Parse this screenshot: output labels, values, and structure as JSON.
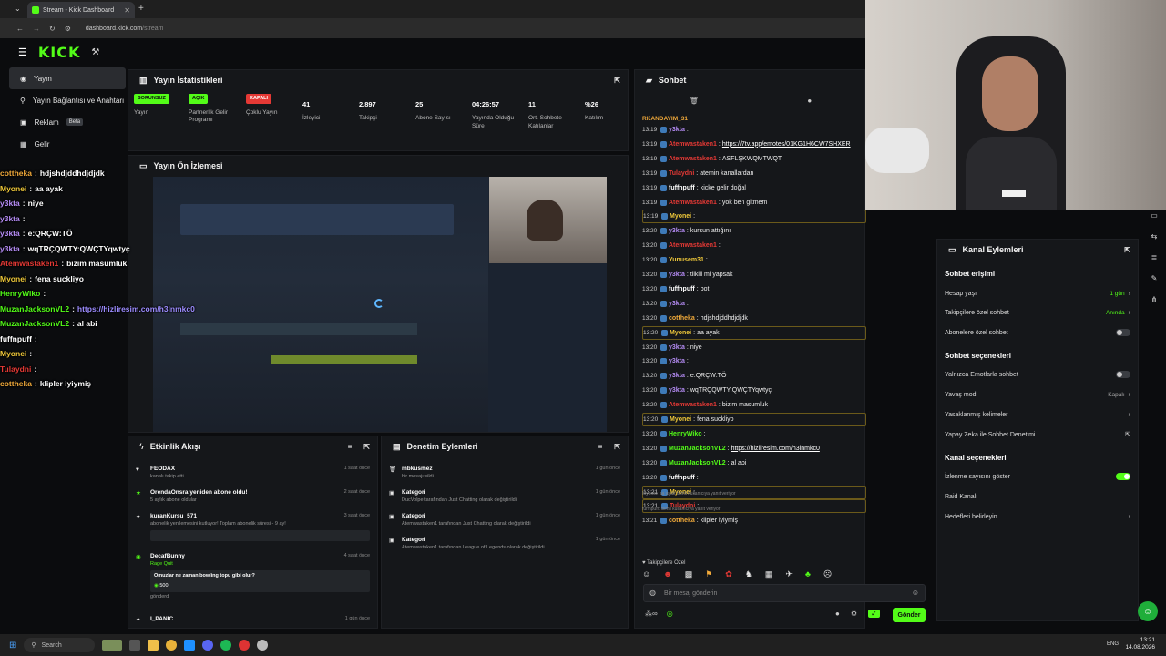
{
  "browser": {
    "tab_title": "Stream - Kick Dashboard",
    "url_host": "dashboard.kick.com",
    "url_path": "/stream"
  },
  "header": {
    "logo": "KICK"
  },
  "sidebar": {
    "items": [
      {
        "label": "Yayın",
        "icon": "broadcast-icon",
        "active": true
      },
      {
        "label": "Yayın Bağlantısı ve Anahtarı",
        "icon": "link-icon"
      },
      {
        "label": "Reklam",
        "icon": "ad-icon",
        "badge": "Beta"
      },
      {
        "label": "Gelir",
        "icon": "revenue-icon"
      }
    ]
  },
  "stats": {
    "title": "Yayın İstatistikleri",
    "items": [
      {
        "value": "SORUNSUZ",
        "label": "Yayın",
        "kind": "pill-green"
      },
      {
        "value": "AÇIK",
        "label": "Partnerlik Gelir Programı",
        "kind": "pill-green"
      },
      {
        "value": "KAPALI",
        "label": "Çoklu Yayın",
        "kind": "pill-red"
      },
      {
        "value": "41",
        "label": "İzleyici"
      },
      {
        "value": "2.897",
        "label": "Takipçi"
      },
      {
        "value": "25",
        "label": "Abone Sayısı"
      },
      {
        "value": "04:26:57",
        "label": "Yayında Olduğu Süre"
      },
      {
        "value": "11",
        "label": "Ort. Sohbete Katılanlar"
      },
      {
        "value": "%26",
        "label": "Katılım"
      }
    ]
  },
  "preview": {
    "title": "Yayın Ön İzlemesi"
  },
  "overlay_chat": [
    {
      "user": "cottheka",
      "msg": "hdjshdjddhdjdjdk",
      "color": "#f0a93a"
    },
    {
      "user": "Myonei",
      "msg": "aa ayak",
      "color": "#f0c93a"
    },
    {
      "user": "y3kta",
      "msg": "niye",
      "color": "#b58cf5"
    },
    {
      "user": "y3kta",
      "msg": "",
      "color": "#b58cf5"
    },
    {
      "user": "y3kta",
      "msg": "e:QRÇW:TÖ",
      "color": "#b58cf5"
    },
    {
      "user": "y3kta",
      "msg": "wqTRÇQWTY:QWÇTYqwtyç",
      "color": "#b58cf5"
    },
    {
      "user": "Atemwastaken1",
      "msg": "bizim masumluk",
      "color": "#e53935"
    },
    {
      "user": "Myonei",
      "msg": "fena suckliyo",
      "color": "#f0c93a"
    },
    {
      "user": "HenryWiko",
      "msg": "",
      "color": "#53fc18"
    },
    {
      "user": "MuzanJacksonVL2",
      "msg": "https://hizliresim.com/h3lnmkc0",
      "color": "#53fc18",
      "link": true
    },
    {
      "user": "MuzanJacksonVL2",
      "msg": "al abi",
      "color": "#53fc18"
    },
    {
      "user": "fuffnpuff",
      "msg": "",
      "color": "#ffffff"
    },
    {
      "user": "Myonei",
      "msg": "",
      "color": "#f0c93a"
    },
    {
      "user": "Tulaydni",
      "msg": "",
      "color": "#e53935"
    },
    {
      "user": "cottheka",
      "msg": "klipler iyiymiş",
      "color": "#f0a93a"
    }
  ],
  "activity": {
    "title": "Etkinlik Akışı",
    "items": [
      {
        "title": "FEODAX",
        "sub": "kanalı takip etti",
        "time": "1 saat önce"
      },
      {
        "title": "OrendaOnsra yeniden abone oldu!",
        "sub": "5 aylık abone oldular",
        "time": "2 saat önce"
      },
      {
        "title": "kuranKursu_571",
        "sub": "abonelik yenilemesini kutluyor! Toplam abonelik süresi - 9 ay!",
        "time": "3 saat önce"
      },
      {
        "title": "DecafBunny",
        "sub": "Rage Quit",
        "time": "4 saat önce"
      },
      {
        "title": "Omuzlar ne zaman bowling topu gibi olur?",
        "sub": "500",
        "time": ""
      },
      {
        "title": "gönderdi",
        "sub": "",
        "time": ""
      },
      {
        "title": "I_PANIC",
        "sub": "",
        "time": "1 gün önce"
      }
    ]
  },
  "moderation": {
    "title": "Denetim Eylemleri",
    "items": [
      {
        "title": "mbkusmez",
        "sub": "bir mesajı sildi",
        "time": "1 gün önce"
      },
      {
        "title": "Kategori",
        "sub": "DucVolpe tarafından Just Chatting olarak değiştirildi",
        "time": "1 gün önce"
      },
      {
        "title": "Kategori",
        "sub": "Atemwastaken1 tarafından Just Chatting olarak değiştirildi",
        "time": "1 gün önce"
      },
      {
        "title": "Kategori",
        "sub": "Atemwastaken1 tarafından League of Legends olarak değiştirildi",
        "time": "1 gün önce"
      }
    ]
  },
  "chat": {
    "title": "Sohbet",
    "pinned": "RKANDAYIM_31",
    "input_placeholder": "Bir mesaj gönderin",
    "send_label": "Gönder",
    "followers_only": "Takipçilere Özel",
    "reply_preview_1": "Myonei: aa ayak isimli kullanıcıya yanıt veriyor",
    "reply_preview_2": "fuffnpuff: isimli kullanıcıya yanıt veriyor",
    "lines": [
      {
        "time": "13:19",
        "user": "y3kta",
        "msg": "",
        "color": "#b58cf5"
      },
      {
        "time": "13:19",
        "user": "Atemwastaken1",
        "msg": "https://7tv.app/emotes/01KG1H6CW7SHXER",
        "color": "#e53935",
        "link": true
      },
      {
        "time": "13:19",
        "user": "Atemwastaken1",
        "msg": "ASFLŞKWQMTWQT",
        "color": "#e53935"
      },
      {
        "time": "13:19",
        "user": "Tulaydni",
        "msg": "atemin kanallardan",
        "color": "#e53935"
      },
      {
        "time": "13:19",
        "user": "fuffnpuff",
        "msg": "kicke gelir doğal",
        "color": "#ffffff"
      },
      {
        "time": "13:19",
        "user": "Atemwastaken1",
        "msg": "yok ben gitmem",
        "color": "#e53935"
      },
      {
        "time": "13:19",
        "user": "Myonei",
        "msg": "",
        "color": "#f0c93a",
        "hl": true
      },
      {
        "time": "13:20",
        "user": "y3kta",
        "msg": "kursun attığını",
        "color": "#b58cf5"
      },
      {
        "time": "13:20",
        "user": "Atemwastaken1",
        "msg": "",
        "color": "#e53935"
      },
      {
        "time": "13:20",
        "user": "Yunusem31",
        "msg": "",
        "color": "#f0c93a"
      },
      {
        "time": "13:20",
        "user": "y3kta",
        "msg": "tilkili mi yapsak",
        "color": "#b58cf5"
      },
      {
        "time": "13:20",
        "user": "fuffnpuff",
        "msg": "bot",
        "color": "#ffffff"
      },
      {
        "time": "13:20",
        "user": "y3kta",
        "msg": "",
        "color": "#b58cf5"
      },
      {
        "time": "13:20",
        "user": "cottheka",
        "msg": "hdjshdjddhdjdjdk",
        "color": "#f0a93a"
      },
      {
        "time": "13:20",
        "user": "Myonei",
        "msg": "aa ayak",
        "color": "#f0c93a",
        "hl": true
      },
      {
        "time": "13:20",
        "user": "y3kta",
        "msg": "niye",
        "color": "#b58cf5"
      },
      {
        "time": "13:20",
        "user": "y3kta",
        "msg": "",
        "color": "#b58cf5"
      },
      {
        "time": "13:20",
        "user": "y3kta",
        "msg": "e:QRÇW:TÖ",
        "color": "#b58cf5"
      },
      {
        "time": "13:20",
        "user": "y3kta",
        "msg": "wqTRÇQWTY:QWÇTYqwtyç",
        "color": "#b58cf5"
      },
      {
        "time": "13:20",
        "user": "Atemwastaken1",
        "msg": "bizim masumluk",
        "color": "#e53935"
      },
      {
        "time": "13:20",
        "user": "Myonei",
        "msg": "fena suckliyo",
        "color": "#f0c93a",
        "hl": true
      },
      {
        "time": "13:20",
        "user": "HenryWiko",
        "msg": "",
        "color": "#53fc18"
      },
      {
        "time": "13:20",
        "user": "MuzanJacksonVL2",
        "msg": "https://hizliresim.com/h3lnmkc0",
        "color": "#53fc18",
        "link": true
      },
      {
        "time": "13:20",
        "user": "MuzanJacksonVL2",
        "msg": "al abi",
        "color": "#53fc18"
      },
      {
        "time": "13:20",
        "user": "fuffnpuff",
        "msg": "",
        "color": "#ffffff"
      },
      {
        "time": "13:21",
        "user": "Myonei",
        "msg": "",
        "color": "#f0c93a",
        "hl": true
      },
      {
        "time": "13:21",
        "user": "Tulaydni",
        "msg": "",
        "color": "#e53935",
        "hl": true
      },
      {
        "time": "13:21",
        "user": "cottheka",
        "msg": "klipler iyiymiş",
        "color": "#f0a93a"
      }
    ]
  },
  "channel_actions": {
    "title": "Kanal Eylemleri",
    "chat_access": "Sohbet erişimi",
    "account_age": {
      "label": "Hesap yaşı",
      "value": "1 gün"
    },
    "followers_chat": {
      "label": "Takipçilere özel sohbet",
      "value": "Anında"
    },
    "subs_chat": {
      "label": "Abonelere özel sohbet"
    },
    "chat_options": "Sohbet seçenekleri",
    "emote_only": {
      "label": "Yalnızca Emotlarla sohbet"
    },
    "slow_mode": {
      "label": "Yavaş mod",
      "value": "Kapalı"
    },
    "banned_words": {
      "label": "Yasaklanmış kelimeler"
    },
    "ai_moderation": {
      "label": "Yapay Zeka ile Sohbet Denetimi"
    },
    "channel_options": "Kanal seçenekleri",
    "show_viewers": {
      "label": "İzlenme sayısını göster",
      "on": true
    },
    "raid": {
      "label": "Raid Kanalı"
    },
    "goals": {
      "label": "Hedefleri belirleyin"
    }
  },
  "taskbar": {
    "search": "Search",
    "lang": "ENG",
    "time": "13:21",
    "date": "14.08.2026"
  }
}
